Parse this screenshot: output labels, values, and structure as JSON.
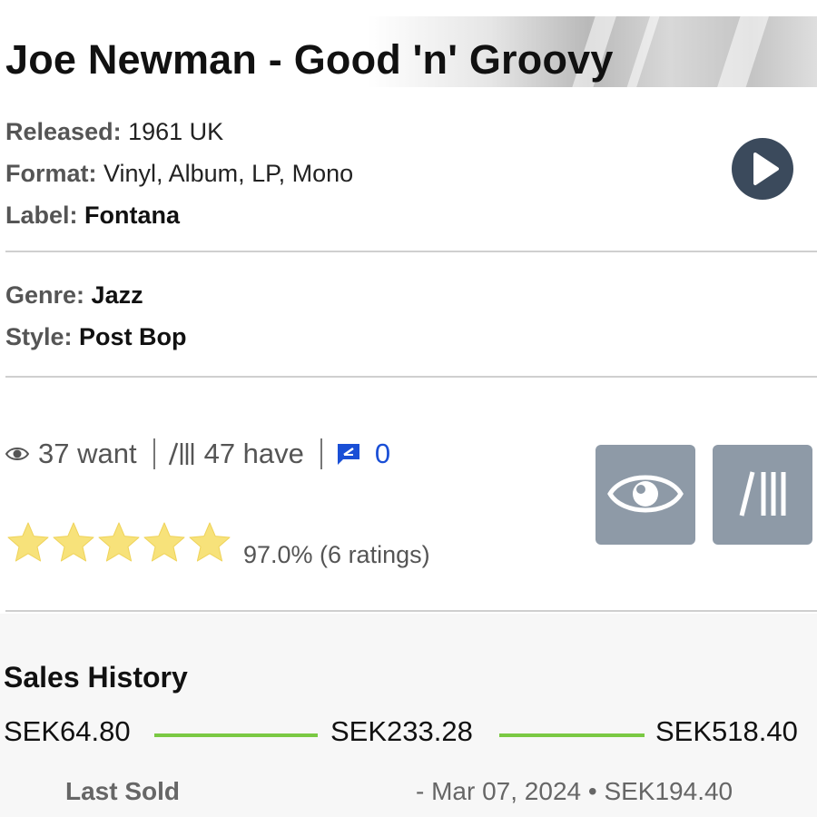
{
  "release": {
    "title": "Joe Newman - Good 'n' Groovy",
    "released_label": "Released:",
    "released_value": "1961 UK",
    "format_label": "Format:",
    "format_value": "Vinyl, Album, LP, Mono",
    "label_label": "Label:",
    "label_value": "Fontana",
    "genre_label": "Genre:",
    "genre_value": "Jazz",
    "style_label": "Style:",
    "style_value": "Post Bop"
  },
  "stats": {
    "want": "37 want",
    "have": "47 have",
    "comments": "0"
  },
  "rating": {
    "stars_filled": 5,
    "stars_total": 5,
    "text": "97.0% (6 ratings)",
    "star_color": "#f7e27a"
  },
  "actions": {
    "want_icon": "eye-icon",
    "collection_icon": "collection-lines-icon",
    "play_icon": "play-icon"
  },
  "sales_history": {
    "title": "Sales History",
    "low": "SEK64.80",
    "median": "SEK233.28",
    "high": "SEK518.40",
    "last_sold_label": "Last Sold",
    "last_sold_value": "- Mar 07, 2024 • SEK194.40",
    "line_color": "#7ac943"
  },
  "colors": {
    "button_gray": "#8e9aa7",
    "play_button": "#3b4a5c",
    "comment_blue": "#1a4fd6"
  }
}
